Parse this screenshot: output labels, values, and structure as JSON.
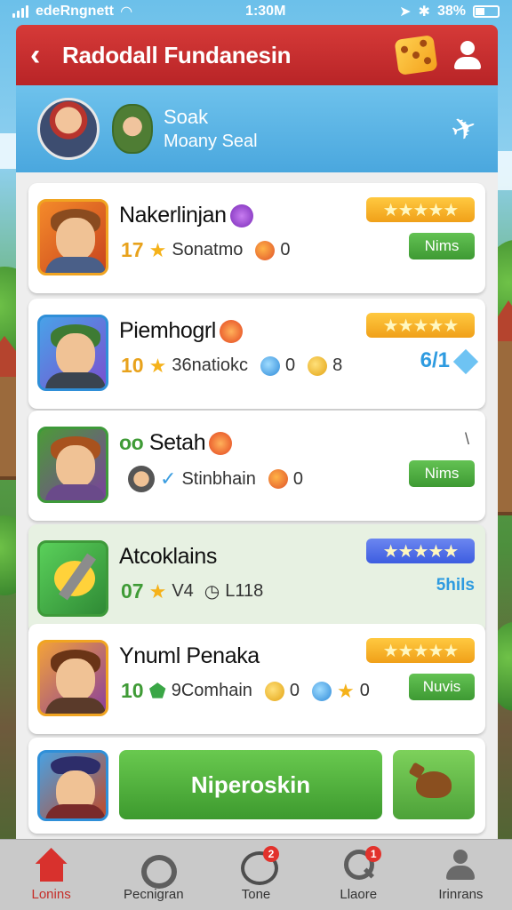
{
  "status_bar": {
    "carrier": "edeRngnett",
    "time": "1:30M",
    "battery": "38%"
  },
  "header": {
    "title": "Radodall Fundanesin"
  },
  "panel": {
    "title": "Soak",
    "subtitle": "Moany Seal"
  },
  "games": [
    {
      "name": "Nakerlinjan",
      "level": "17",
      "stat": "Sonatmo",
      "coins": "0",
      "action": "Nims",
      "rating_stars": 5
    },
    {
      "name": "Piemhogrl",
      "level": "10",
      "stat": "36natiokc",
      "coins": "0",
      "extra": "8",
      "side": "6/1",
      "rating_stars": 5
    },
    {
      "name": "Setah",
      "level_icon": "oo",
      "stat": "Stinbhain",
      "coins": "0",
      "action": "Nims",
      "mark": "\\"
    },
    {
      "name": "Atcoklains",
      "level": "07",
      "stat": "V4",
      "stat2": "L118",
      "side": "5hils",
      "rating_stars": 5
    },
    {
      "name": "Ynuml Penaka",
      "level": "10",
      "stat": "9Comhain",
      "coins": "0",
      "coins2": "0",
      "action": "Nuvis",
      "rating_stars": 5
    }
  ],
  "cta": {
    "label": "Niperoskin"
  },
  "bottom_nav": [
    {
      "label": "Lonins",
      "active": true
    },
    {
      "label": "Pecnigran",
      "badge": ""
    },
    {
      "label": "Tone",
      "badge": "2"
    },
    {
      "label": "Llaore",
      "badge": "1"
    },
    {
      "label": "Irinrans"
    }
  ],
  "colors": {
    "header": "#c92e2f",
    "panel": "#58b2e4",
    "accent_green": "#4caa3a",
    "rating_gold": "#f3a91d"
  }
}
